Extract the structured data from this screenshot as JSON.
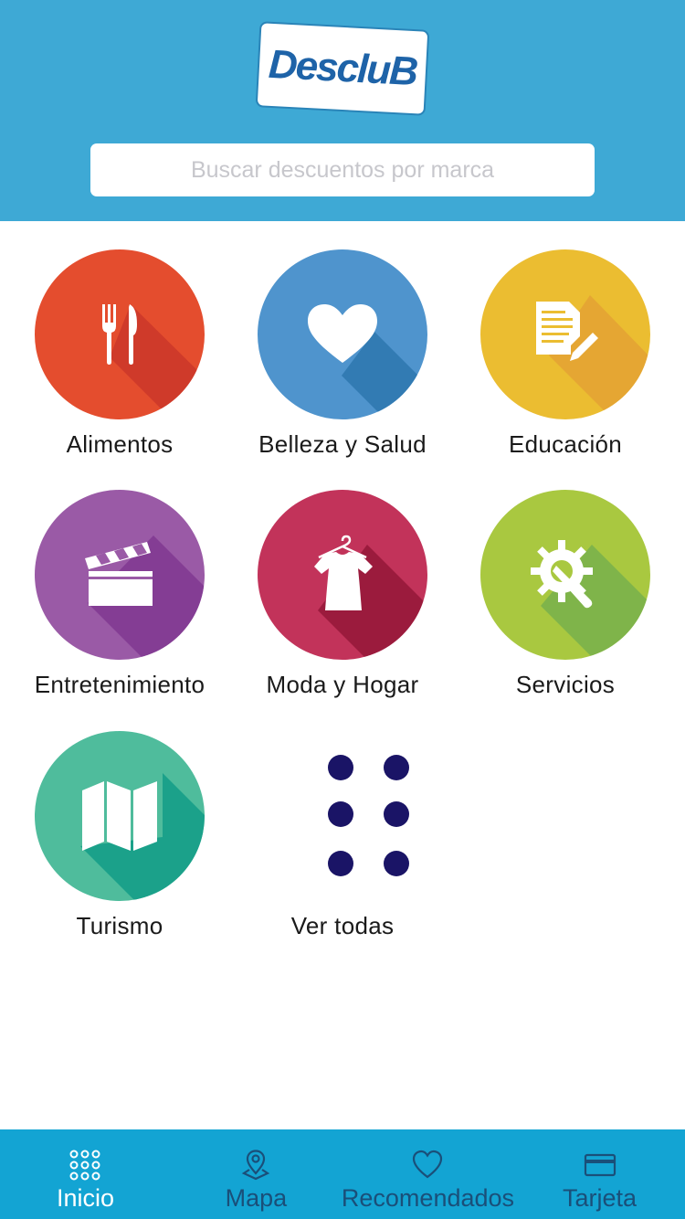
{
  "header": {
    "logo_text": "DescluB",
    "search_placeholder": "Buscar descuentos por marca"
  },
  "categories": [
    {
      "label": "Alimentos",
      "color": "#e44d2e",
      "icon": "fork-knife-icon"
    },
    {
      "label": "Belleza y Salud",
      "color": "#4f94cd",
      "icon": "heart-icon"
    },
    {
      "label": "Educación",
      "color": "#ebbd31",
      "icon": "document-pencil-icon"
    },
    {
      "label": "Entretenimiento",
      "color": "#9a5aa6",
      "icon": "clapperboard-icon"
    },
    {
      "label": "Moda y Hogar",
      "color": "#c2335a",
      "icon": "shirt-hanger-icon"
    },
    {
      "label": "Servicios",
      "color": "#a9c840",
      "icon": "gear-wrench-icon"
    },
    {
      "label": "Turismo",
      "color": "#4fbc9c",
      "icon": "map-icon"
    },
    {
      "label": "Ver todas",
      "color": "#1a1466",
      "icon": "dots-grid-icon"
    }
  ],
  "tabbar": {
    "items": [
      {
        "label": "Inicio",
        "icon": "grid-dots-icon",
        "active": true
      },
      {
        "label": "Mapa",
        "icon": "map-pin-icon",
        "active": false
      },
      {
        "label": "Recomendados",
        "icon": "heart-outline-icon",
        "active": false
      },
      {
        "label": "Tarjeta",
        "icon": "card-icon",
        "active": false
      }
    ]
  }
}
